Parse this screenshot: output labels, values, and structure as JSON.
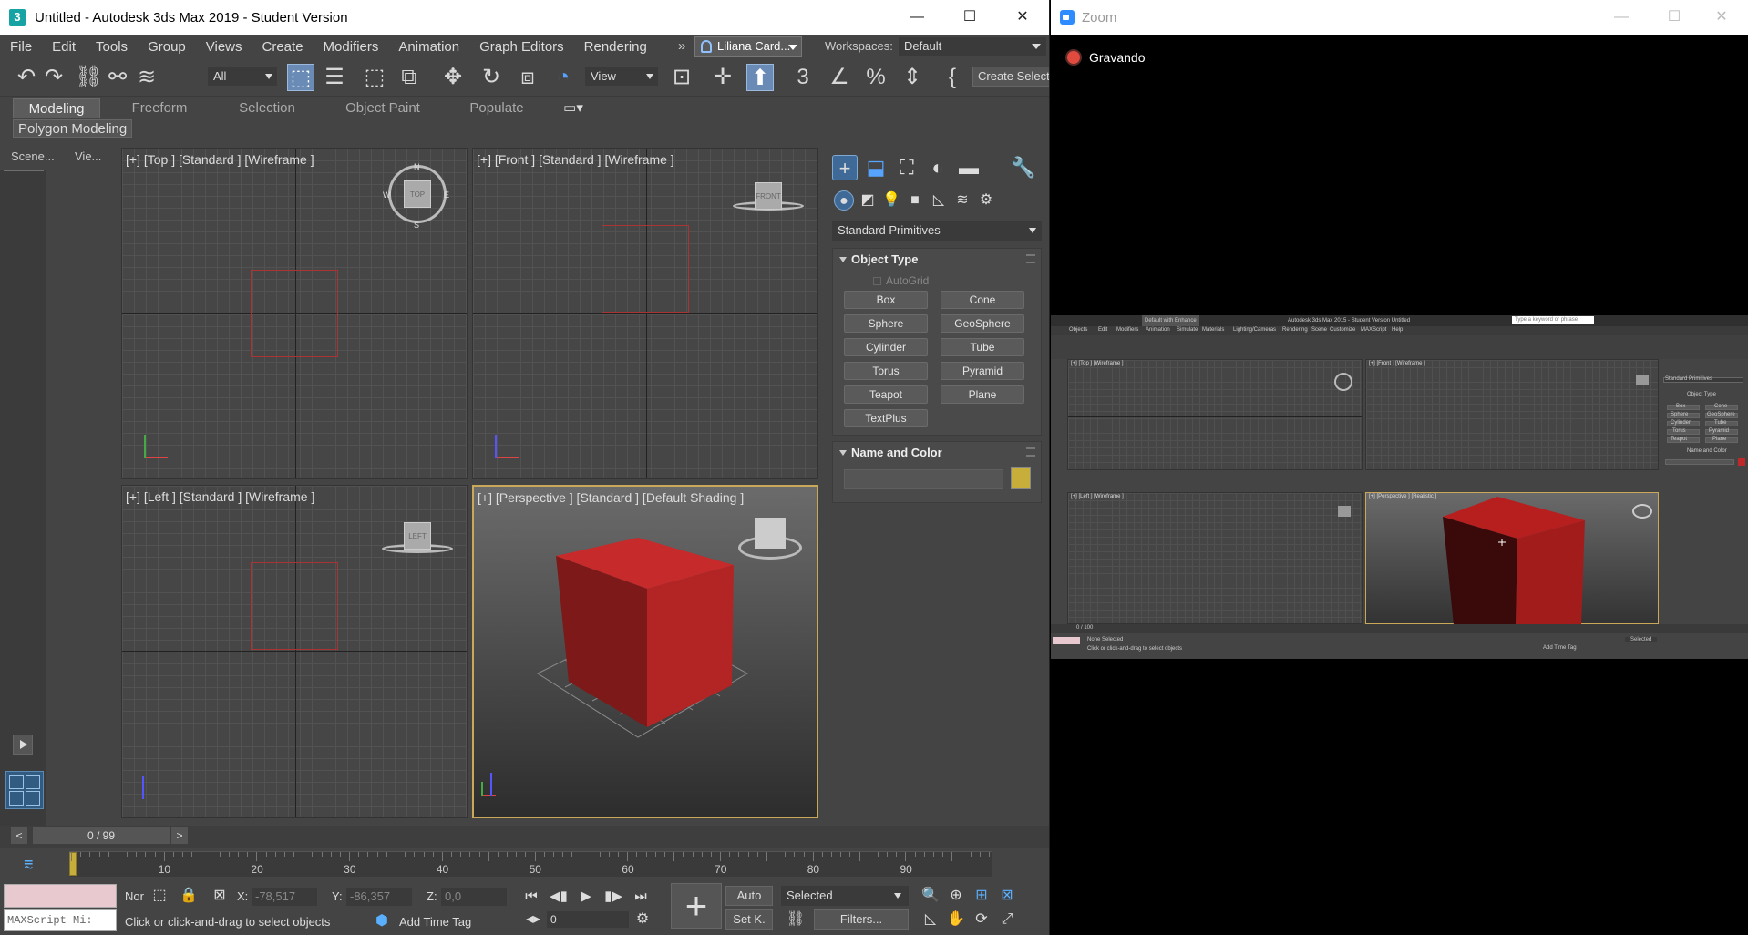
{
  "max": {
    "title": "Untitled - Autodesk 3ds Max 2019 - Student Version",
    "app_icon_label": "3",
    "window_buttons": {
      "minimize": "—",
      "maximize": "☐",
      "close": "✕"
    },
    "menus": [
      "File",
      "Edit",
      "Tools",
      "Group",
      "Views",
      "Create",
      "Modifiers",
      "Animation",
      "Graph Editors",
      "Rendering"
    ],
    "menu_more": "»",
    "user": "Liliana Card...",
    "workspaces_label": "Workspaces:",
    "workspace_value": "Default",
    "selection_filter": "All",
    "ref_coord": "View",
    "create_selection_set": "Create Select",
    "ribbon_tabs": [
      "Modeling",
      "Freeform",
      "Selection",
      "Object Paint",
      "Populate"
    ],
    "ribbon_sub": "Polygon Modeling",
    "scene_tabs": [
      "Scene...",
      "Vie..."
    ],
    "viewports": {
      "top": "[+] [Top ] [Standard ] [Wireframe ]",
      "front": "[+] [Front ] [Standard ] [Wireframe ]",
      "left": "[+] [Left ] [Standard ] [Wireframe ]",
      "perspective": "[+] [Perspective ] [Standard ] [Default Shading ]"
    },
    "viewcube": {
      "top": "TOP",
      "front": "FRONT",
      "left": "LEFT",
      "n": "N",
      "s": "S",
      "e": "E",
      "w": "W"
    },
    "command_panel": {
      "category": "Standard Primitives",
      "object_type_title": "Object Type",
      "autogrid": "AutoGrid",
      "buttons": [
        "Box",
        "Cone",
        "Sphere",
        "GeoSphere",
        "Cylinder",
        "Tube",
        "Torus",
        "Pyramid",
        "Teapot",
        "Plane",
        "TextPlus"
      ],
      "name_color_title": "Name and Color",
      "object_color": "#c7ad3a"
    },
    "time_slider": {
      "value": "0 / 99",
      "prev": "<",
      "next": ">"
    },
    "track_ticks": [
      "10",
      "20",
      "30",
      "40",
      "50",
      "60",
      "70",
      "80",
      "90"
    ],
    "status": {
      "maxscript": "MAXScript Mi:",
      "prompt": "Click or click-and-drag to select objects",
      "selection_mode": "Nor",
      "x_label": "X:",
      "x_value": "-78,517",
      "y_label": "Y:",
      "y_value": "-86,357",
      "z_label": "Z:",
      "z_value": "0,0",
      "add_time_tag": "Add Time Tag",
      "auto_key": "Auto",
      "set_key": "Set K.",
      "key_filter_set": "Selected",
      "filters": "Filters...",
      "frame": "0"
    }
  },
  "zoom": {
    "title": "Zoom",
    "recording_label": "Gravando",
    "window_buttons": {
      "minimize": "—",
      "maximize": "☐",
      "close": "✕"
    },
    "shared": {
      "title": "Autodesk 3ds Max 2015 - Student Version    Untitled",
      "workspace": "Default with Enhance",
      "search": "Type a keyword or phrase",
      "menus": [
        "Objects",
        "Edit",
        "Modifiers",
        "Animation",
        "Simulate",
        "Materials",
        "Lighting/Cameras",
        "Rendering",
        "Scene",
        "Customize",
        "MAXScript",
        "Help"
      ],
      "vp_top": "[+] [Top ] [Wireframe ]",
      "vp_front": "[+] [Front ] [Wireframe ]",
      "vp_left": "[+] [Left ] [Wireframe ]",
      "vp_persp": "[+] [Perspective ] [Realistic ]",
      "panel_category": "Standard Primitives",
      "panel_object_type": "Object Type",
      "panel_buttons": [
        "Box",
        "Cone",
        "Sphere",
        "GeoSphere",
        "Cylinder",
        "Tube",
        "Torus",
        "Pyramid",
        "Teapot",
        "Plane"
      ],
      "panel_name_color": "Name and Color",
      "time": "0 / 100",
      "status_none": "None Selected",
      "status_prompt": "Click or click-and-drag to select objects",
      "key_set": "Selected",
      "add_time_tag": "Add Time Tag"
    }
  }
}
